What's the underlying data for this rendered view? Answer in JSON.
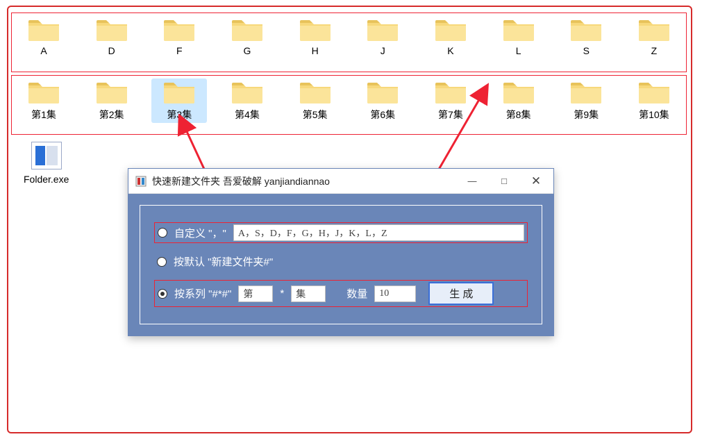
{
  "row1": [
    "A",
    "D",
    "F",
    "G",
    "H",
    "J",
    "K",
    "L",
    "S",
    "Z"
  ],
  "row2": [
    "第1集",
    "第2集",
    "第3集",
    "第4集",
    "第5集",
    "第6集",
    "第7集",
    "第8集",
    "第9集",
    "第10集"
  ],
  "exe_label": "Folder.exe",
  "window": {
    "title": "快速新建文件夹 吾爱破解 yanjiandiannao",
    "minimize": "—",
    "maximize": "□",
    "close": "✕",
    "option_custom": "自定义 \"，\"",
    "custom_value": "A，S，D，F，G，H，J，K，L，Z",
    "option_default": "按默认 \"新建文件夹#\"",
    "option_series": "按系列 \"#*#\"",
    "series_prefix": "第",
    "asterisk": "*",
    "series_suffix": "集",
    "qty_label": "数量",
    "qty_value": "10",
    "generate": "生  成"
  }
}
